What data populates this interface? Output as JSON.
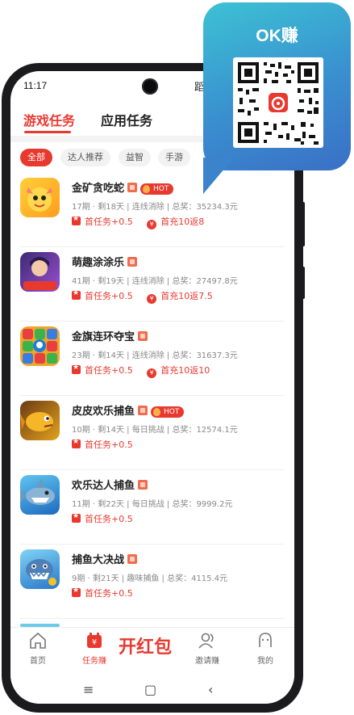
{
  "status_bar": {
    "time": "11:17",
    "right_text": "蹈"
  },
  "tabs": [
    {
      "label": "游戏任务",
      "active": true
    },
    {
      "label": "应用任务",
      "active": false
    }
  ],
  "chips": [
    {
      "label": "全部",
      "active": true
    },
    {
      "label": "达人推荐",
      "active": false
    },
    {
      "label": "益智",
      "active": false
    },
    {
      "label": "手游",
      "active": false
    }
  ],
  "games": [
    {
      "name": "金矿贪吃蛇",
      "hot": true,
      "hot_label": "HOT",
      "meta": "17期 · 剩18天 | 连线消除 | 总奖：35234.3元",
      "tags": [
        "首任务+0.5",
        "首充10返8"
      ]
    },
    {
      "name": "萌趣涂涂乐",
      "hot": false,
      "meta": "41期 · 剩19天 | 连线消除 | 总奖：27497.8元",
      "tags": [
        "首任务+0.5",
        "首充10返7.5"
      ]
    },
    {
      "name": "金旗连环夺宝",
      "hot": false,
      "meta": "23期 · 剩14天 | 连线消除 | 总奖：31637.3元",
      "tags": [
        "首任务+0.5",
        "首充10返10"
      ]
    },
    {
      "name": "皮皮欢乐捕鱼",
      "hot": true,
      "hot_label": "HOT",
      "meta": "10期 · 剩14天 | 每日挑战 | 总奖：12574.1元",
      "tags": [
        "首任务+0.5"
      ]
    },
    {
      "name": "欢乐达人捕鱼",
      "hot": false,
      "meta": "11期 · 剩22天 | 每日挑战 | 总奖：9999.2元",
      "tags": [
        "首任务+0.5"
      ]
    },
    {
      "name": "捕鱼大决战",
      "hot": false,
      "meta": "9期 · 剩21天 | 趣味捕鱼 | 总奖：4115.4元",
      "tags": [
        "首任务+0.5"
      ]
    }
  ],
  "bottom_nav": {
    "home": "首页",
    "tasks": "任务赚",
    "center": "开红包",
    "invite": "邀请赚",
    "me": "我的"
  },
  "overlay": {
    "title": "OK赚"
  },
  "colors": {
    "accent": "#e8392f",
    "bubble": "#3a8fcf"
  }
}
